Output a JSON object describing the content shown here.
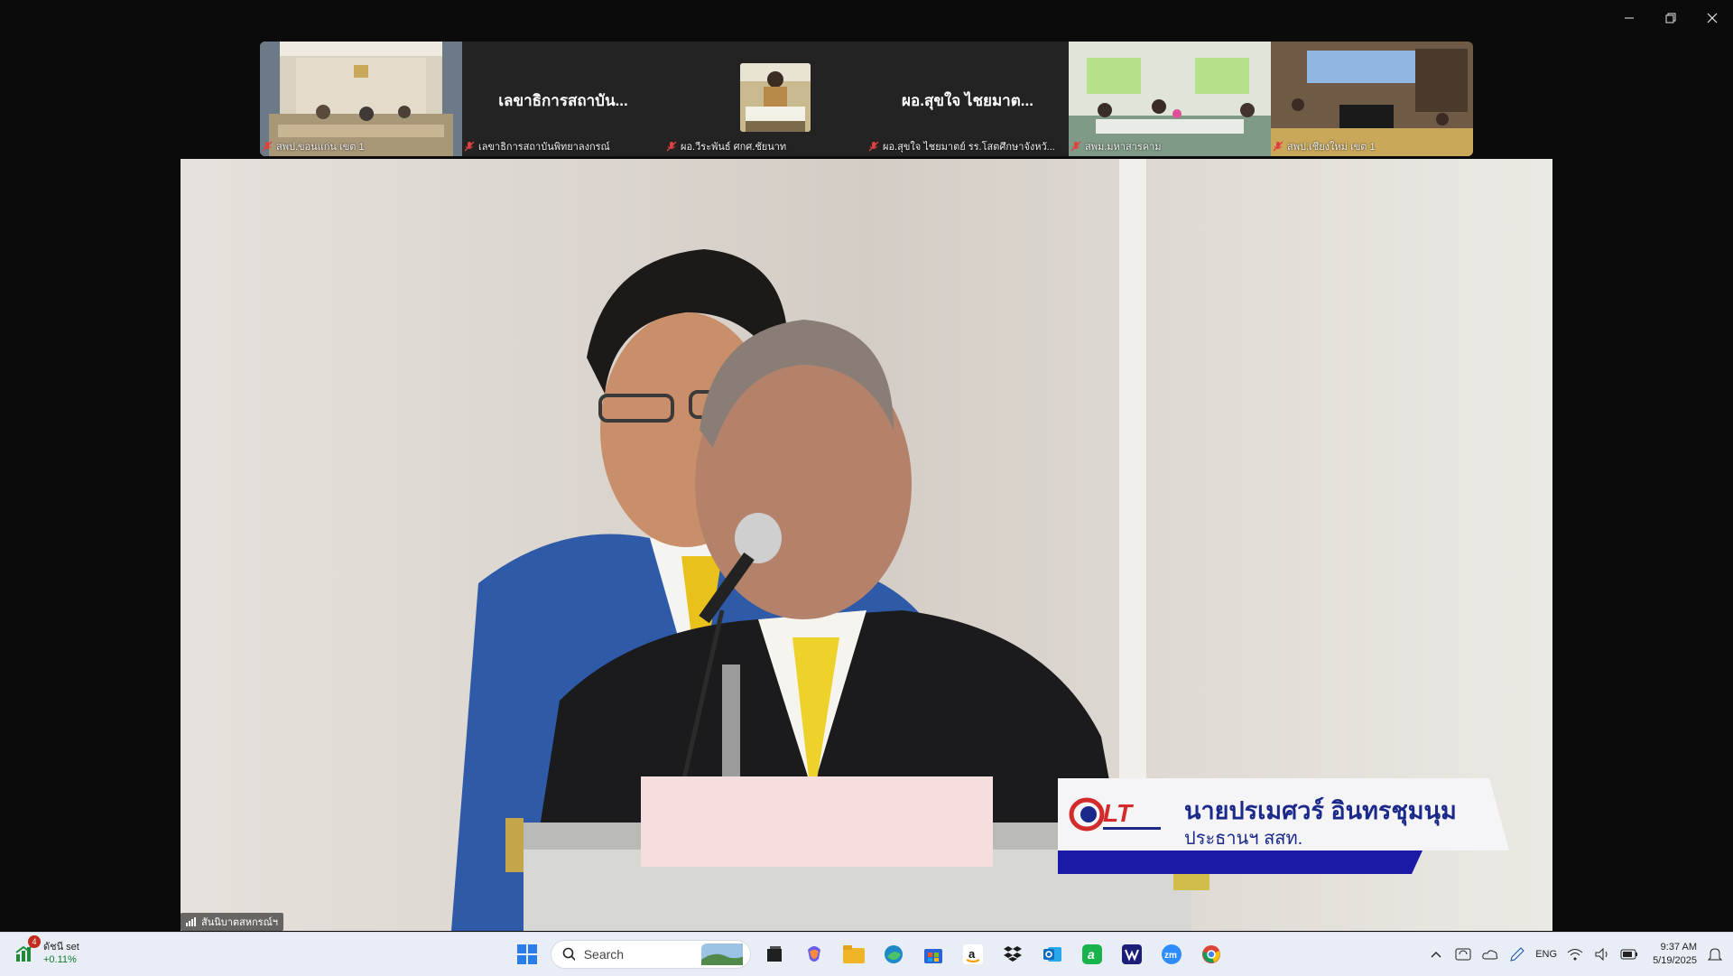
{
  "window_controls": {
    "minimize_icon": "minimize-icon",
    "restore_icon": "restore-icon",
    "close_icon": "close-icon"
  },
  "participants": [
    {
      "label": "สพป.ขอนแก่น เขต 1",
      "display": "video",
      "muted": true
    },
    {
      "label": "เลขาธิการสถาบันพิทยาลงกรณ์",
      "display": "name",
      "big_name": "เลขาธิการสถาบัน...",
      "muted": true
    },
    {
      "label": "ผอ.วีระพันธ์ ศกศ.ชัยนาท",
      "display": "avatar",
      "muted": true
    },
    {
      "label": "ผอ.สุขใจ ไชยมาตย์ รร.โสตศึกษาจังหวั...",
      "display": "name",
      "big_name": "ผอ.สุขใจ ไชยมาต...",
      "muted": true
    },
    {
      "label": "สพม.มหาสารคาม",
      "display": "video",
      "muted": true
    },
    {
      "label": "สพป.เชียงใหม่ เขต 1",
      "display": "video",
      "muted": true
    }
  ],
  "main_video": {
    "speaker_label": "สันนิบาตสหกรณ์ฯ",
    "lower_third": {
      "name": "นายปรเมศวร์ อินทรชุมนุม",
      "title": "ประธานฯ สสท.",
      "logo_text": "CLT"
    }
  },
  "taskbar": {
    "widget": {
      "badge": "4",
      "title": "ดัชนี set",
      "change": "+0.11%"
    },
    "search": {
      "placeholder": "Search"
    },
    "apps": [
      "start-icon",
      "search",
      "task-view-icon",
      "copilot-icon",
      "file-explorer-icon",
      "edge-icon",
      "store-icon",
      "amazon-icon",
      "dropbox-icon",
      "outlook-icon",
      "line-icon",
      "webex-icon",
      "zoom-icon",
      "chrome-icon"
    ],
    "tray": {
      "language": "ENG",
      "time": "9:37 AM",
      "date": "5/19/2025"
    }
  },
  "colors": {
    "taskbar_bg": "#e9eef6",
    "lower_third_text": "#1b2a8a",
    "lower_third_bar": "#1a1aa6",
    "muted_red": "#e04040",
    "widget_green": "#0a7a2a"
  }
}
